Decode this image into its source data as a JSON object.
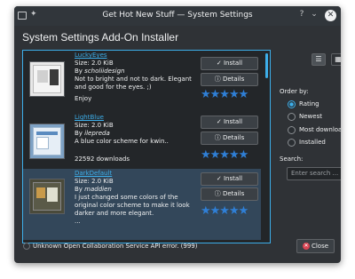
{
  "window": {
    "title": "Get Hot New Stuff — System Settings",
    "help_glyph": "?",
    "minimize_glyph": "⌄",
    "maximize_glyph": "⌃",
    "close_glyph": "✕"
  },
  "heading": "System Settings Add-On Installer",
  "items": [
    {
      "name": "LuckyEyes",
      "size": "Size: 2.0 KiB",
      "author_prefix": "By ",
      "author": "scholiidesign",
      "description": "Not to bright and not to dark. Elegant and good for the eyes. ;)",
      "extra": "Enjoy",
      "install_label": "✓ Install",
      "details_label": "ⓘ Details",
      "rating_stars": "★★★★★"
    },
    {
      "name": "LightBlue",
      "size": "Size: 2.0 KiB",
      "author_prefix": "By ",
      "author": "ilepreda",
      "description": "A blue color scheme for kwin..",
      "extra": "22592 downloads",
      "install_label": "✓ Install",
      "details_label": "ⓘ Details",
      "rating_stars": "★★★★★"
    },
    {
      "name": "DarkDefault",
      "size": "Size: 2.0 KiB",
      "author_prefix": "By ",
      "author": "maddien",
      "description": "I just changed some colors of the original color scheme to make it look darker and more elegant.",
      "extra": "...",
      "install_label": "✓ Install",
      "details_label": "ⓘ Details",
      "rating_stars": "★★★★★"
    }
  ],
  "sidebar": {
    "order_label": "Order by:",
    "order_options": [
      "Rating",
      "Newest",
      "Most downloads",
      "Installed"
    ],
    "selected_order": "Rating",
    "search_label": "Search:",
    "search_placeholder": "Enter search ..."
  },
  "status": {
    "message": "Unknown Open Collaboration Service API error. (999)"
  },
  "footer": {
    "close_label": "Close"
  },
  "colors": {
    "accent": "#3daee9",
    "star": "#2f7fd6",
    "window_bg": "#2f3236",
    "close_icon": "#da4453"
  }
}
